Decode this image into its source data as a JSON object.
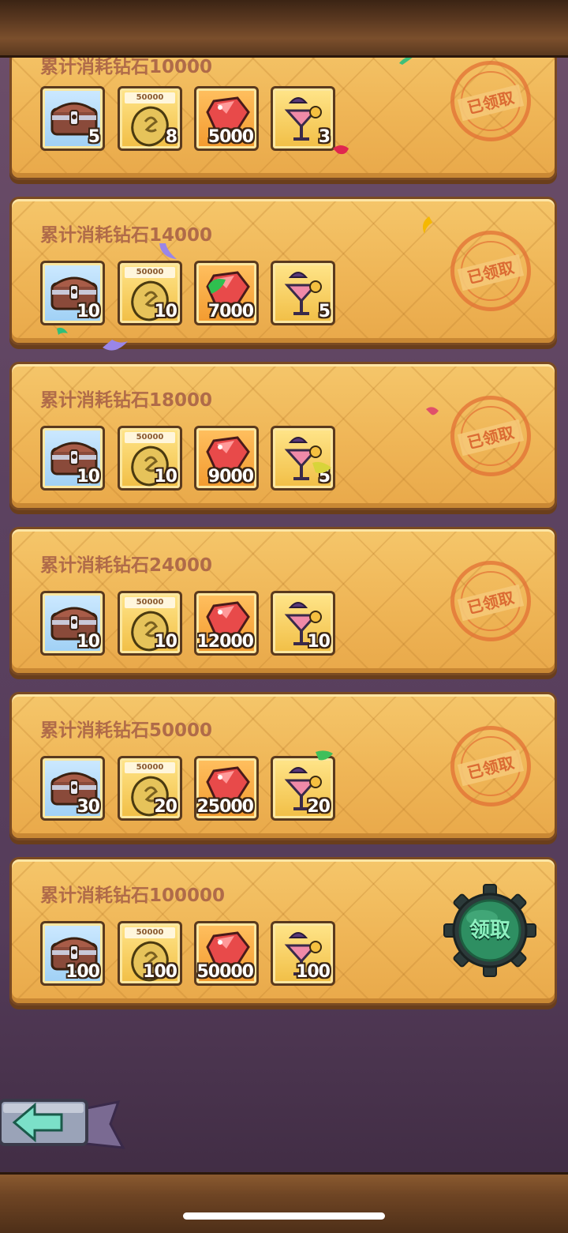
{
  "colors": {
    "panel": "#efb556",
    "title_text": "#b06b49",
    "stamp": "#e27034",
    "claim_button": "#2e8f62"
  },
  "rows": [
    {
      "title": "累计消耗钻石10000",
      "chest": "5",
      "coin_label": "50000",
      "coin": "8",
      "gem": "5000",
      "drink": "3",
      "status": "已领取",
      "claimed": true
    },
    {
      "title": "累计消耗钻石14000",
      "chest": "10",
      "coin_label": "50000",
      "coin": "10",
      "gem": "7000",
      "drink": "5",
      "status": "已领取",
      "claimed": true
    },
    {
      "title": "累计消耗钻石18000",
      "chest": "10",
      "coin_label": "50000",
      "coin": "10",
      "gem": "9000",
      "drink": "5",
      "status": "已领取",
      "claimed": true
    },
    {
      "title": "累计消耗钻石24000",
      "chest": "10",
      "coin_label": "50000",
      "coin": "10",
      "gem": "12000",
      "drink": "10",
      "status": "已领取",
      "claimed": true
    },
    {
      "title": "累计消耗钻石50000",
      "chest": "30",
      "coin_label": "50000",
      "coin": "20",
      "gem": "25000",
      "drink": "20",
      "status": "已领取",
      "claimed": true
    },
    {
      "title": "累计消耗钻石100000",
      "chest": "100",
      "coin_label": "50000",
      "coin": "100",
      "gem": "50000",
      "drink": "100",
      "status": "领取",
      "claimed": false
    }
  ],
  "icons": {
    "chest": "treasure-chest-icon",
    "coin": "gold-coin-icon",
    "gem": "red-gem-icon",
    "drink": "cocktail-icon",
    "back": "back-arrow-icon"
  }
}
